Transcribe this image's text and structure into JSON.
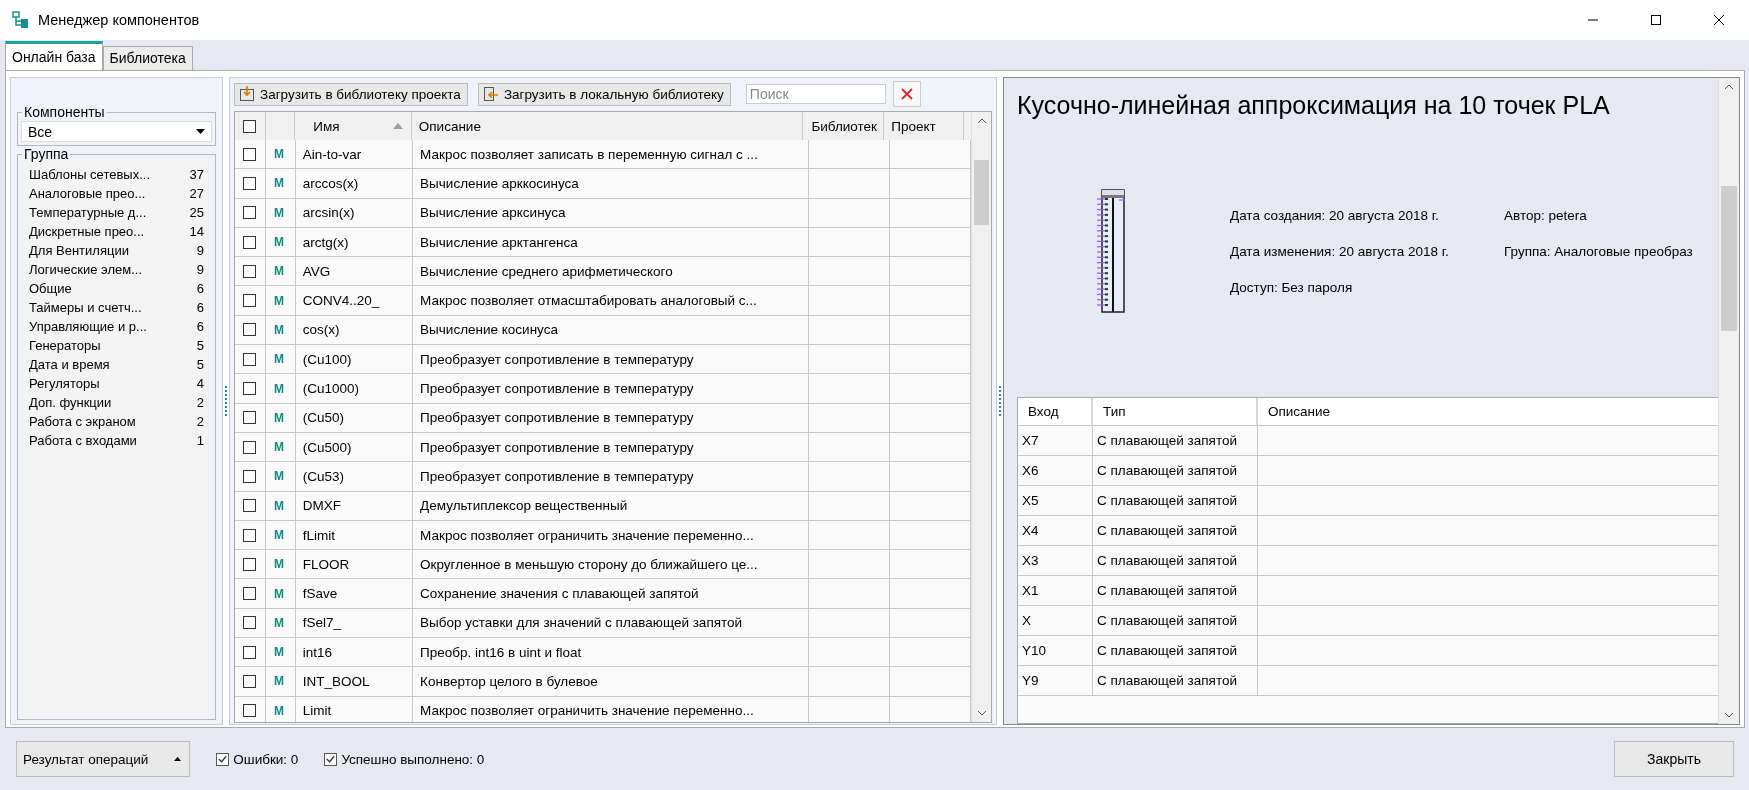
{
  "window": {
    "title": "Менеджер компонентов"
  },
  "tabs": [
    {
      "label": "Онлайн база",
      "selected": true
    },
    {
      "label": "Библиотека",
      "selected": false
    }
  ],
  "filter": {
    "components_label": "Компоненты",
    "components_value": "Все",
    "group_label": "Группа",
    "groups": [
      {
        "name": "Шаблоны сетевых...",
        "count": "37"
      },
      {
        "name": "Аналоговые прео...",
        "count": "27"
      },
      {
        "name": "Температурные д...",
        "count": "25"
      },
      {
        "name": "Дискретные прео...",
        "count": "14"
      },
      {
        "name": "Для Вентиляции",
        "count": "9"
      },
      {
        "name": "Логические элем...",
        "count": "9"
      },
      {
        "name": "Общие",
        "count": "6"
      },
      {
        "name": "Таймеры и счетч...",
        "count": "6"
      },
      {
        "name": "Управляющие и р...",
        "count": "6"
      },
      {
        "name": "Генераторы",
        "count": "5"
      },
      {
        "name": "Дата и время",
        "count": "5"
      },
      {
        "name": "Регуляторы",
        "count": "4"
      },
      {
        "name": "Доп. функции",
        "count": "2"
      },
      {
        "name": "Работа с экраном",
        "count": "2"
      },
      {
        "name": "Работа с входами",
        "count": "1"
      }
    ]
  },
  "toolbar": {
    "buttons": [
      {
        "label": "Загрузить в библиотеку проекта",
        "kind": "project"
      },
      {
        "label": "Загрузить в локальную библиотеку",
        "kind": "local"
      }
    ],
    "search": {
      "placeholder": "Поиск"
    }
  },
  "components_table": {
    "all_checked": false,
    "columns": [
      {
        "label": "Имя",
        "sorted": true
      },
      {
        "label": "Описание",
        "sorted": false
      },
      {
        "label": "Библиотек",
        "sorted": false
      },
      {
        "label": "Проект",
        "sorted": false
      }
    ],
    "rows": [
      {
        "checked": false,
        "mark": "M",
        "name": "Ain-to-var",
        "description": "Макрос позволяет записать в переменную сигнал с ..."
      },
      {
        "checked": false,
        "mark": "M",
        "name": "arccos(x)",
        "description": "Вычисление арккосинуса"
      },
      {
        "checked": false,
        "mark": "M",
        "name": "arcsin(x)",
        "description": "Вычисление арксинуса"
      },
      {
        "checked": false,
        "mark": "M",
        "name": "arctg(x)",
        "description": "Вычисление арктангенса"
      },
      {
        "checked": false,
        "mark": "M",
        "name": "AVG",
        "description": "Вычисление среднего арифметического"
      },
      {
        "checked": false,
        "mark": "M",
        "name": "CONV4..20_",
        "description": "Макрос позволяет отмасштабировать аналоговый с..."
      },
      {
        "checked": false,
        "mark": "M",
        "name": "cos(x)",
        "description": "Вычисление косинуса"
      },
      {
        "checked": false,
        "mark": "M",
        "name": "(Cu100)",
        "description": "Преобразует сопротивление в температуру"
      },
      {
        "checked": false,
        "mark": "M",
        "name": "(Cu1000)",
        "description": "Преобразует сопротивление в температуру"
      },
      {
        "checked": false,
        "mark": "M",
        "name": "(Cu50)",
        "description": "Преобразует сопротивление в температуру"
      },
      {
        "checked": false,
        "mark": "M",
        "name": "(Cu500)",
        "description": "Преобразует сопротивление в температуру"
      },
      {
        "checked": false,
        "mark": "M",
        "name": "(Cu53)",
        "description": "Преобразует сопротивление в температуру"
      },
      {
        "checked": false,
        "mark": "M",
        "name": "DMXF",
        "description": "Демультиплексор вещественный"
      },
      {
        "checked": false,
        "mark": "M",
        "name": "fLimit",
        "description": "Макрос позволяет ограничить значение переменно..."
      },
      {
        "checked": false,
        "mark": "M",
        "name": "FLOOR",
        "description": "Округленное в меньшую сторону до ближайшего це..."
      },
      {
        "checked": false,
        "mark": "M",
        "name": "fSave",
        "description": "Сохранение значения с плавающей запятой"
      },
      {
        "checked": false,
        "mark": "M",
        "name": "fSel7_",
        "description": "Выбор уставки для значений с плавающей запятой"
      },
      {
        "checked": false,
        "mark": "M",
        "name": "int16",
        "description": "Преобр. int16 в uint и float"
      },
      {
        "checked": false,
        "mark": "M",
        "name": "INT_BOOL",
        "description": "Конвертор целого в булевое"
      },
      {
        "checked": false,
        "mark": "M",
        "name": "Limit",
        "description": "Макрос позволяет ограничить значение переменно..."
      }
    ]
  },
  "details": {
    "title": "Кусочно-линейная аппроксимация на 10 точек PLA",
    "info": [
      "Дата создания: 20 августа 2018 г.",
      "Автор: petera",
      "Дата изменения: 20 августа 2018 г.",
      "Группа: Аналоговые преобраз",
      "Доступ: Без пароля"
    ],
    "inputs": {
      "columns": [
        "Вход",
        "Тип",
        "Описание"
      ],
      "rows": [
        {
          "input": "X7",
          "type": "С плавающей запятой"
        },
        {
          "input": "X6",
          "type": "С плавающей запятой"
        },
        {
          "input": "X5",
          "type": "С плавающей запятой"
        },
        {
          "input": "X4",
          "type": "С плавающей запятой"
        },
        {
          "input": "X3",
          "type": "С плавающей запятой"
        },
        {
          "input": "X1",
          "type": "С плавающей запятой"
        },
        {
          "input": "X",
          "type": "С плавающей запятой"
        },
        {
          "input": "Y10",
          "type": "С плавающей запятой"
        },
        {
          "input": "Y9",
          "type": "С плавающей запятой"
        }
      ]
    }
  },
  "status": {
    "result_button": "Результат операций",
    "checks": [
      {
        "label": "Ошибки: 0",
        "checked": true
      },
      {
        "label": "Успешно выполнено: 0",
        "checked": true
      }
    ]
  },
  "close_button": "Закрыть"
}
